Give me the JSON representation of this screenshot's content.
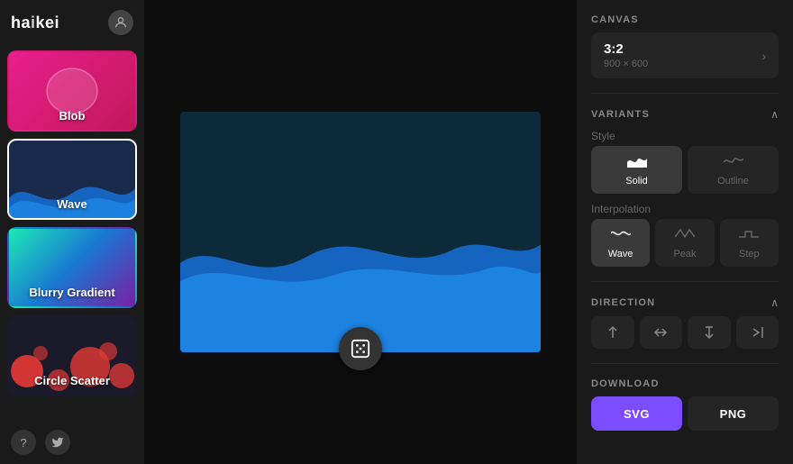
{
  "sidebar": {
    "logo": "haikei",
    "items": [
      {
        "id": "blob",
        "label": "Blob",
        "active": false
      },
      {
        "id": "wave",
        "label": "Wave",
        "active": true
      },
      {
        "id": "blurry-gradient",
        "label": "Blurry Gradient",
        "active": false
      },
      {
        "id": "circle-scatter",
        "label": "Circle Scatter",
        "active": false
      }
    ],
    "footer": {
      "help_icon": "?",
      "twitter_icon": "t"
    }
  },
  "canvas": {
    "section_title": "CANVAS",
    "ratio": "3:2",
    "dimensions": "900 × 600",
    "chevron": "›"
  },
  "variants": {
    "section_title": "VARIANTS",
    "style_label": "Style",
    "style_options": [
      {
        "id": "solid",
        "label": "Solid",
        "active": true
      },
      {
        "id": "outline",
        "label": "Outline",
        "active": false
      }
    ],
    "interpolation_label": "Interpolation",
    "interpolation_options": [
      {
        "id": "wave",
        "label": "Wave",
        "active": true
      },
      {
        "id": "peak",
        "label": "Peak",
        "active": false
      },
      {
        "id": "step",
        "label": "Step",
        "active": false
      }
    ]
  },
  "direction": {
    "section_title": "DIRECTION",
    "options": [
      {
        "id": "left-in",
        "symbol": "⊳|",
        "active": false
      },
      {
        "id": "up",
        "symbol": "⊼",
        "active": false
      },
      {
        "id": "down",
        "symbol": "⊽",
        "active": false
      },
      {
        "id": "right-in",
        "symbol": "|⊲",
        "active": false
      }
    ]
  },
  "download": {
    "section_title": "DOWNLOAD",
    "svg_label": "SVG",
    "png_label": "PNG"
  },
  "randomize_button": "⚄"
}
